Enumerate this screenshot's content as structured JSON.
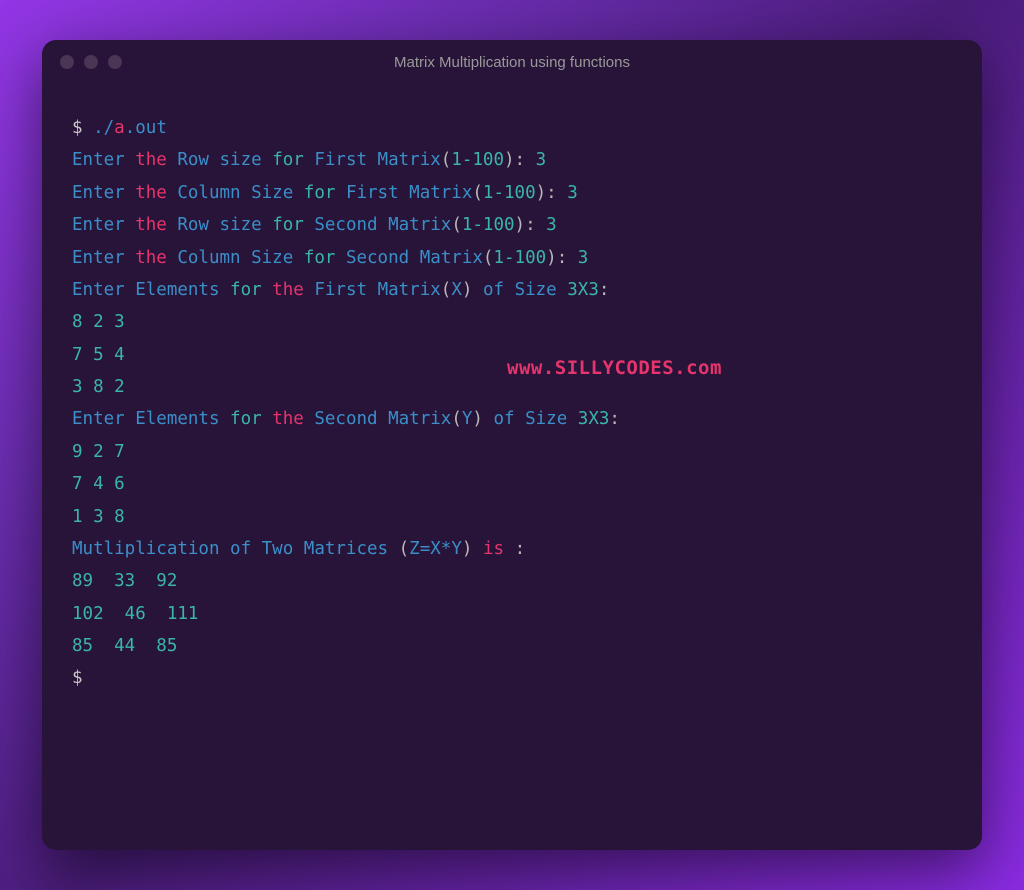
{
  "window": {
    "title": "Matrix Multiplication using functions"
  },
  "watermark": "www.SILLYCODES.com",
  "terminal": {
    "prompt1": "$ ",
    "cmd_dot": ".",
    "cmd_slash": "/",
    "cmd_a": "a",
    "cmd_ext": ".out",
    "l1_enter": "Enter ",
    "l1_the": "the",
    "l1_rest": " Row size ",
    "l1_for": "for",
    "l1_first": " First Matrix",
    "l1_p1": "(",
    "l1_range": "1-100",
    "l1_p2": ")",
    "l1_colon": ": ",
    "l1_val": "3",
    "l2_enter": "Enter ",
    "l2_the": "the",
    "l2_rest": " Column Size ",
    "l2_for": "for",
    "l2_first": " First Matrix",
    "l2_p1": "(",
    "l2_range": "1-100",
    "l2_p2": ")",
    "l2_colon": ": ",
    "l2_val": "3",
    "l3_enter": "Enter ",
    "l3_the": "the",
    "l3_rest": " Row size ",
    "l3_for": "for",
    "l3_second": " Second Matrix",
    "l3_p1": "(",
    "l3_range": "1-100",
    "l3_p2": ")",
    "l3_colon": ": ",
    "l3_val": "3",
    "l4_enter": "Enter ",
    "l4_the": "the",
    "l4_rest": " Column Size ",
    "l4_for": "for",
    "l4_second": " Second Matrix",
    "l4_p1": "(",
    "l4_range": "1-100",
    "l4_p2": ")",
    "l4_colon": ": ",
    "l4_val": "3",
    "l5_enter": "Enter Elements ",
    "l5_for": "for",
    "l5_space": " ",
    "l5_the": "the",
    "l5_matrix": " First Matrix",
    "l5_p1": "(",
    "l5_x": "X",
    "l5_p2": ")",
    "l5_of": " of Size ",
    "l5_size": "3X3",
    "l5_colon": ":",
    "mx_r1": "8 2 3",
    "mx_r2": "7 5 4",
    "mx_r3": "3 8 2",
    "l6_enter": "Enter Elements ",
    "l6_for": "for",
    "l6_space": " ",
    "l6_the": "the",
    "l6_matrix": " Second Matrix",
    "l6_p1": "(",
    "l6_y": "Y",
    "l6_p2": ")",
    "l6_of": " of Size ",
    "l6_size": "3X3",
    "l6_colon": ":",
    "my_r1": "9 2 7",
    "my_r2": "7 4 6",
    "my_r3": "1 3 8",
    "l7_mult": "Mutliplication of Two Matrices ",
    "l7_p1": "(",
    "l7_z": "Z=X*Y",
    "l7_p2": ")",
    "l7_space": " ",
    "l7_is": "is",
    "l7_colon": " :",
    "mz_r1": "89  33  92  ",
    "mz_r2": "102  46  111  ",
    "mz_r3": "85  44  85  ",
    "prompt2": "$ "
  }
}
